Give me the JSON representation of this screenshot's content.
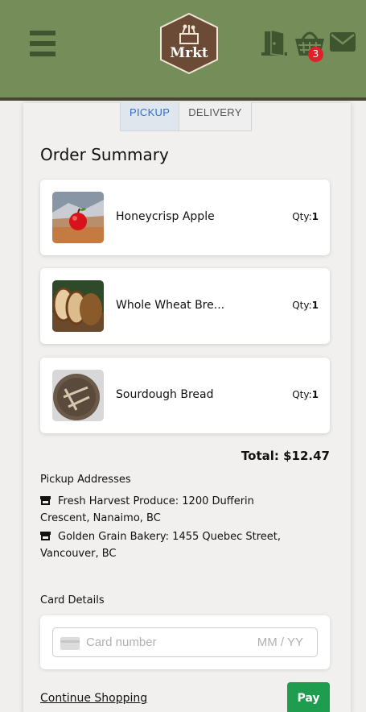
{
  "header": {
    "logo_text": "Mrkt",
    "cart_count": "3",
    "icons": [
      "menu-icon",
      "door-icon",
      "cart-icon",
      "mail-icon"
    ]
  },
  "tabs": [
    {
      "label": "PICKUP",
      "active": true
    },
    {
      "label": "DELIVERY",
      "active": false
    }
  ],
  "order": {
    "title": "Order Summary",
    "items": [
      {
        "name": "Honeycrisp Apple",
        "qty_label": "Qty:",
        "qty": "1"
      },
      {
        "name": "Whole Wheat Bre...",
        "qty_label": "Qty:",
        "qty": "1"
      },
      {
        "name": "Sourdough Bread",
        "qty_label": "Qty:",
        "qty": "1"
      }
    ],
    "total": "Total: $12.47"
  },
  "pickup": {
    "title": "Pickup Addresses",
    "addresses": [
      "Fresh Harvest Produce: 1200 Dufferin Crescent, Nanaimo, BC",
      "Golden Grain Bakery: 1455 Quebec Street, Vancouver, BC"
    ]
  },
  "payment": {
    "label": "Card Details",
    "card_placeholder": "Card number",
    "expiry_placeholder": "MM / YY"
  },
  "footer": {
    "continue_label": "Continue Shopping",
    "pay_label": "Pay"
  },
  "colors": {
    "header_bg": "#758d58",
    "header_icons": "#3e5530",
    "logo_bg": "#6b4a36",
    "badge": "#e21f2a",
    "tab_active": "#2c6fcf",
    "pay_button": "#1f9d4f"
  }
}
